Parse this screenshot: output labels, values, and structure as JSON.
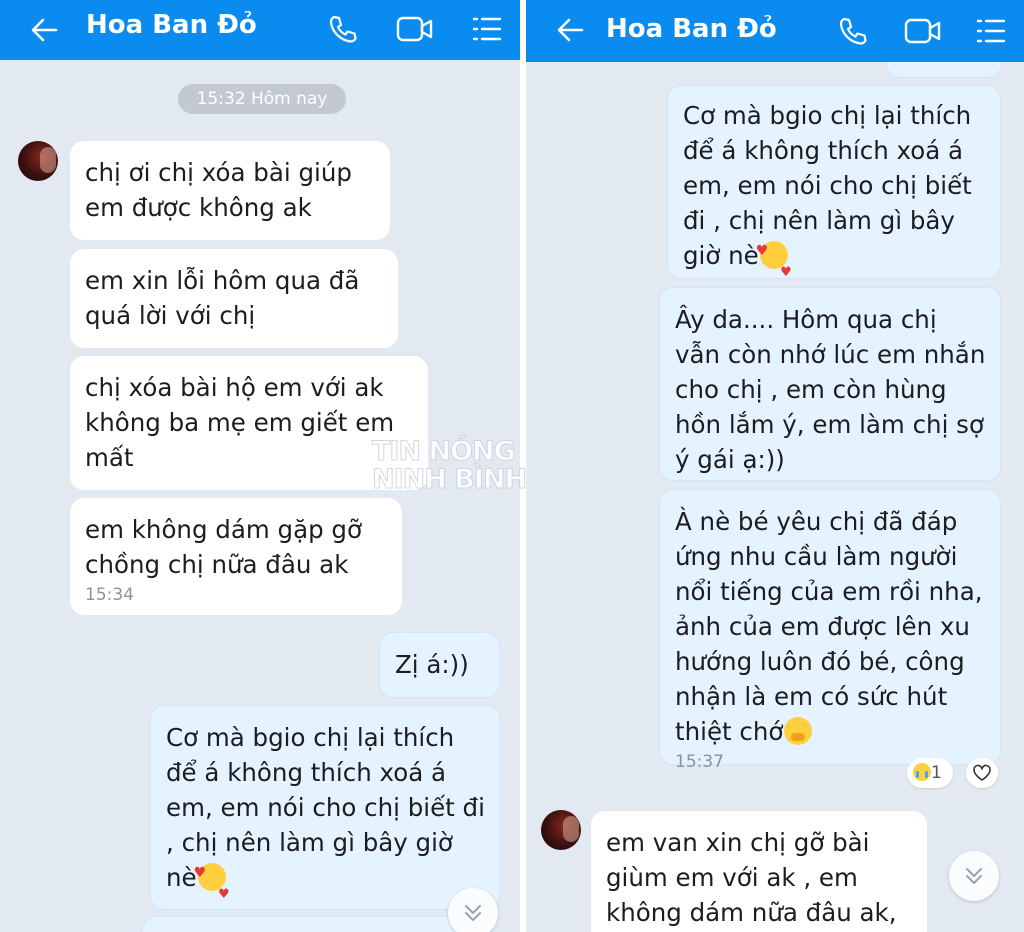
{
  "screens": [
    {
      "header": {
        "title": "Hoa Ban Đỏ"
      },
      "time_divider": "15:32 Hôm nay",
      "messages": [
        {
          "text": "chị ơi chị xóa bài giúp em được không ak"
        },
        {
          "text": "em xin lỗi hôm qua đã quá lời với chị"
        },
        {
          "text": "chị xóa bài hộ em với ak không ba mẹ em giết em mất"
        },
        {
          "text": "em không dám gặp gỡ chồng chị nữa đâu ak",
          "time": "15:34"
        },
        {
          "text": "Zị á:))"
        },
        {
          "text": "Cơ mà bgio chị lại thích để á không thích xoá á em,  em nói cho chị biết đi , chị nên làm gì bây giờ nè"
        }
      ]
    },
    {
      "header": {
        "title": "Hoa Ban Đỏ"
      },
      "messages": [
        {
          "text": "Cơ mà bgio chị lại thích để á không thích xoá á em,  em nói cho chị biết đi , chị nên làm gì bây giờ nè"
        },
        {
          "text": "Ây da....  Hôm qua chị vẫn còn nhớ lúc em nhắn cho chị , em còn hùng hồn lắm ý,  em làm chị sợ ý gái ạ:))"
        },
        {
          "text": "À nè bé yêu chị đã đáp ứng nhu cầu làm người nổi tiếng của em rồi nha, ảnh của em được lên xu hướng luôn đó bé,  công nhận là em có sức hút thiệt chớ",
          "time": "15:37",
          "reaction_count": "1"
        },
        {
          "text": "em van xin chị gỡ bài giùm em với ak ,  em không dám nữa đâu ak,"
        }
      ]
    }
  ],
  "watermark": {
    "line1": "TIN NÓNG",
    "line2": "NINH BÌNH"
  },
  "icons": [
    "back-arrow-icon",
    "phone-icon",
    "video-call-icon",
    "menu-list-icon",
    "scroll-down-icon",
    "crying-emoji-icon",
    "heart-icon",
    "smiling-hearts-emoji-icon",
    "giggle-emoji-icon"
  ],
  "colors": {
    "header": "#0a8bf0",
    "background": "#e2e9f1",
    "incoming_bubble": "#ffffff",
    "outgoing_bubble": "#e5f2ff",
    "timestamp": "#8a939c"
  }
}
